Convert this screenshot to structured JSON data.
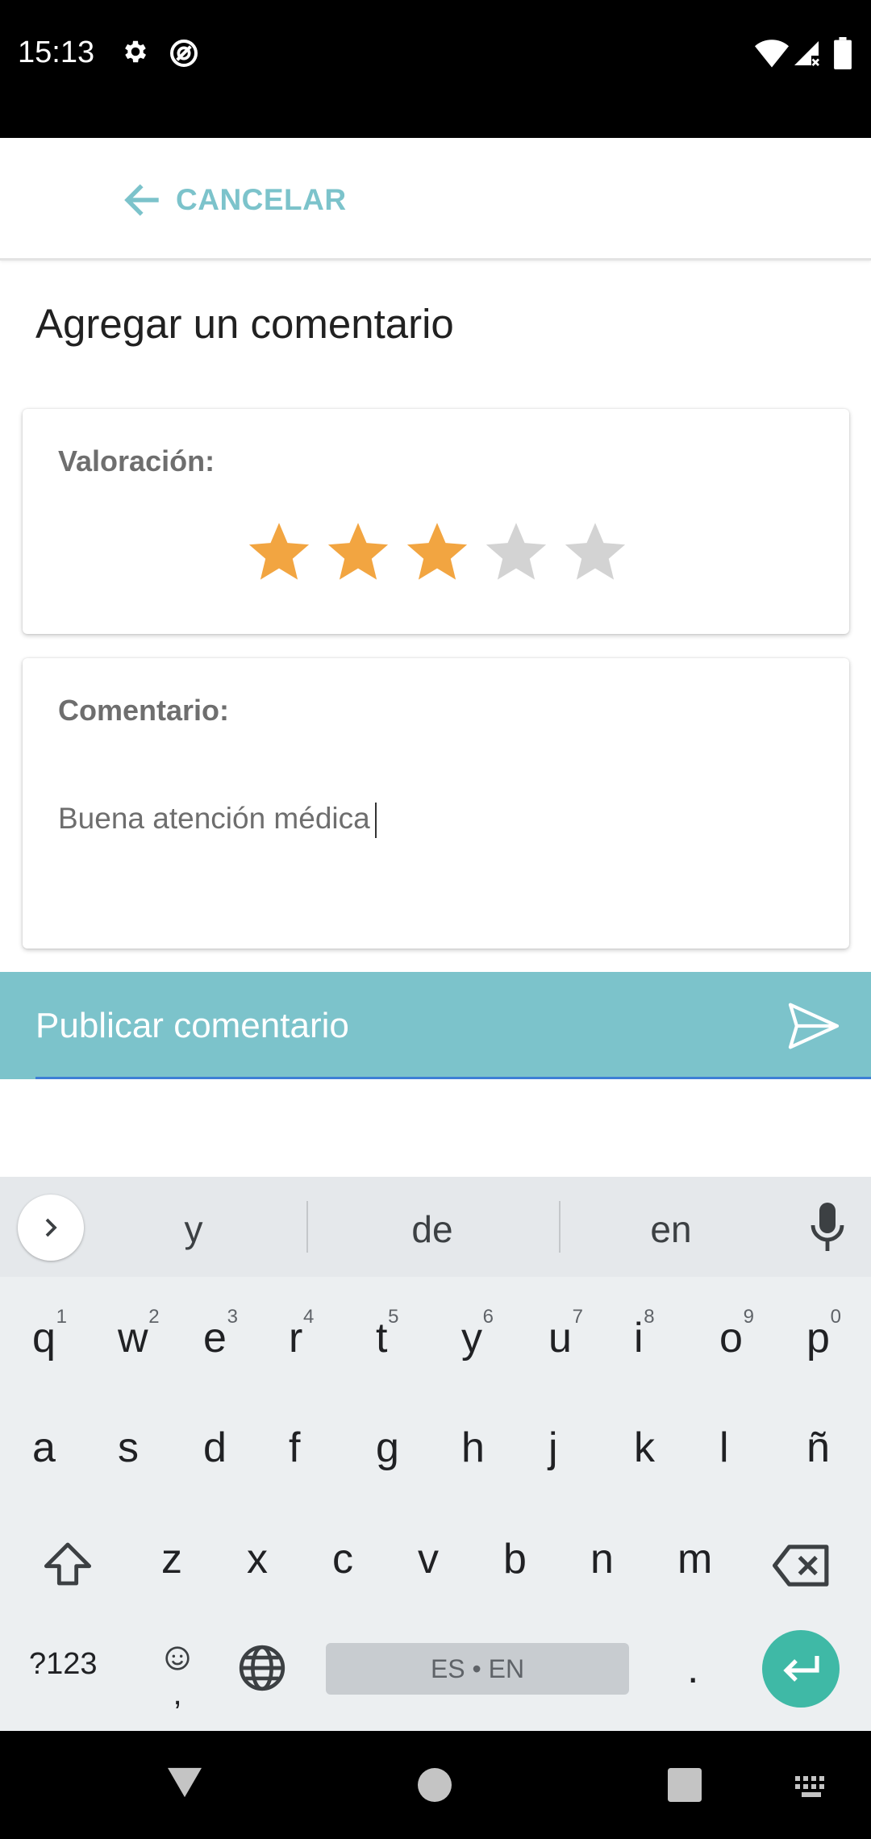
{
  "status_bar": {
    "time": "15:13",
    "icons": [
      "settings-icon",
      "do-not-disturb-icon",
      "wifi-icon",
      "signal-icon",
      "battery-icon"
    ]
  },
  "toolbar": {
    "back_label": "CANCELAR"
  },
  "page": {
    "title": "Agregar un comentario"
  },
  "rating_card": {
    "label": "Valoración:",
    "rating": 3,
    "max": 5,
    "filled_color": "#F2A541",
    "empty_color": "#D3D3D3"
  },
  "comment_card": {
    "label": "Comentario:",
    "value": "Buena atención médica"
  },
  "publish": {
    "label": "Publicar comentario",
    "bg_color": "#7CC3CB"
  },
  "keyboard": {
    "suggestions": [
      "y",
      "de",
      "en"
    ],
    "row1": [
      {
        "k": "q",
        "h": "1"
      },
      {
        "k": "w",
        "h": "2"
      },
      {
        "k": "e",
        "h": "3"
      },
      {
        "k": "r",
        "h": "4"
      },
      {
        "k": "t",
        "h": "5"
      },
      {
        "k": "y",
        "h": "6"
      },
      {
        "k": "u",
        "h": "7"
      },
      {
        "k": "i",
        "h": "8"
      },
      {
        "k": "o",
        "h": "9"
      },
      {
        "k": "p",
        "h": "0"
      }
    ],
    "row2": [
      "a",
      "s",
      "d",
      "f",
      "g",
      "h",
      "j",
      "k",
      "l",
      "ñ"
    ],
    "row3": [
      "z",
      "x",
      "c",
      "v",
      "b",
      "n",
      "m"
    ],
    "symbols_label": "?123",
    "comma_label": ",",
    "space_label": "ES • EN",
    "period_label": ".",
    "enter_color": "#3FB9A6"
  }
}
